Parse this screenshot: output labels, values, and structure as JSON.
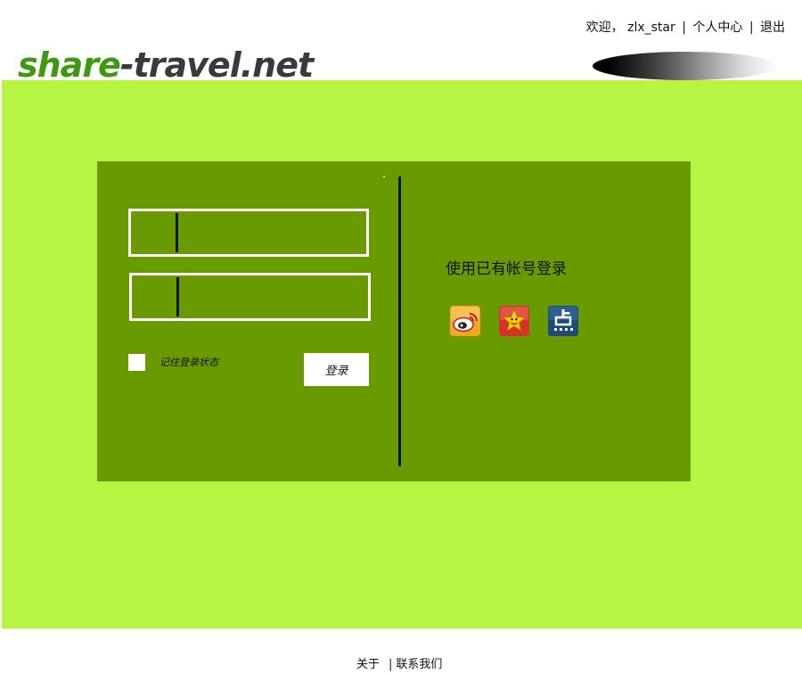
{
  "header": {
    "logo": {
      "part1": "share",
      "part2": "-travel.net"
    },
    "nav": {
      "welcome": "欢迎，",
      "username": "zlx_star",
      "separator": "|",
      "profile": "个人中心",
      "logout": "退出"
    }
  },
  "login": {
    "remember_label": "记住登录状态",
    "login_button": "登录"
  },
  "social_login": {
    "title": "使用已有帐号登录",
    "providers": [
      {
        "name": "weibo-icon"
      },
      {
        "name": "qq-icon"
      },
      {
        "name": "dianping-icon"
      }
    ]
  },
  "footer": {
    "about": "关于",
    "separator": "|",
    "contact": "联系我们"
  },
  "colors": {
    "background_green": "#b8f542",
    "panel_green": "#699b00",
    "logo_green": "#3d9a10",
    "logo_gray": "#3a3a3a"
  }
}
